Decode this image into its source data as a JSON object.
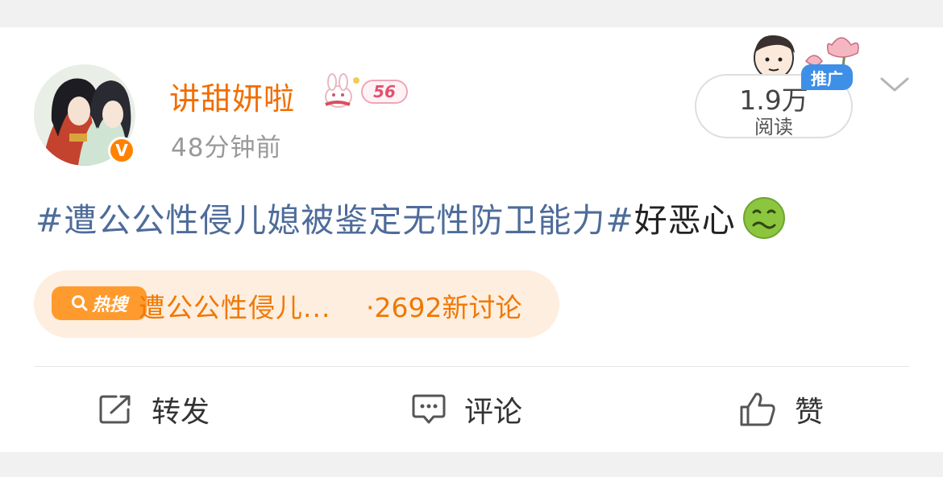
{
  "post": {
    "username": "讲甜妍啦",
    "level": "56",
    "timestamp": "48分钟前",
    "read_count": "1.9万",
    "read_label": "阅读",
    "promo_tag": "推广",
    "content": {
      "hashtag": "#遭公公性侵儿媳被鉴定无性防卫能力#",
      "text": "好恶心",
      "emoji": "nauseated-face-emoji"
    },
    "hot_search": {
      "badge": "热搜",
      "topic": "遭公公性侵儿...",
      "count": "·2692新讨论"
    },
    "actions": {
      "repost": "转发",
      "comment": "评论",
      "like": "赞"
    }
  },
  "colors": {
    "username": "#f26d00",
    "hashtag": "#4e6c9a",
    "hot_orange": "#f07800",
    "promo_blue": "#3e8fe8",
    "verified": "#ff8200"
  }
}
